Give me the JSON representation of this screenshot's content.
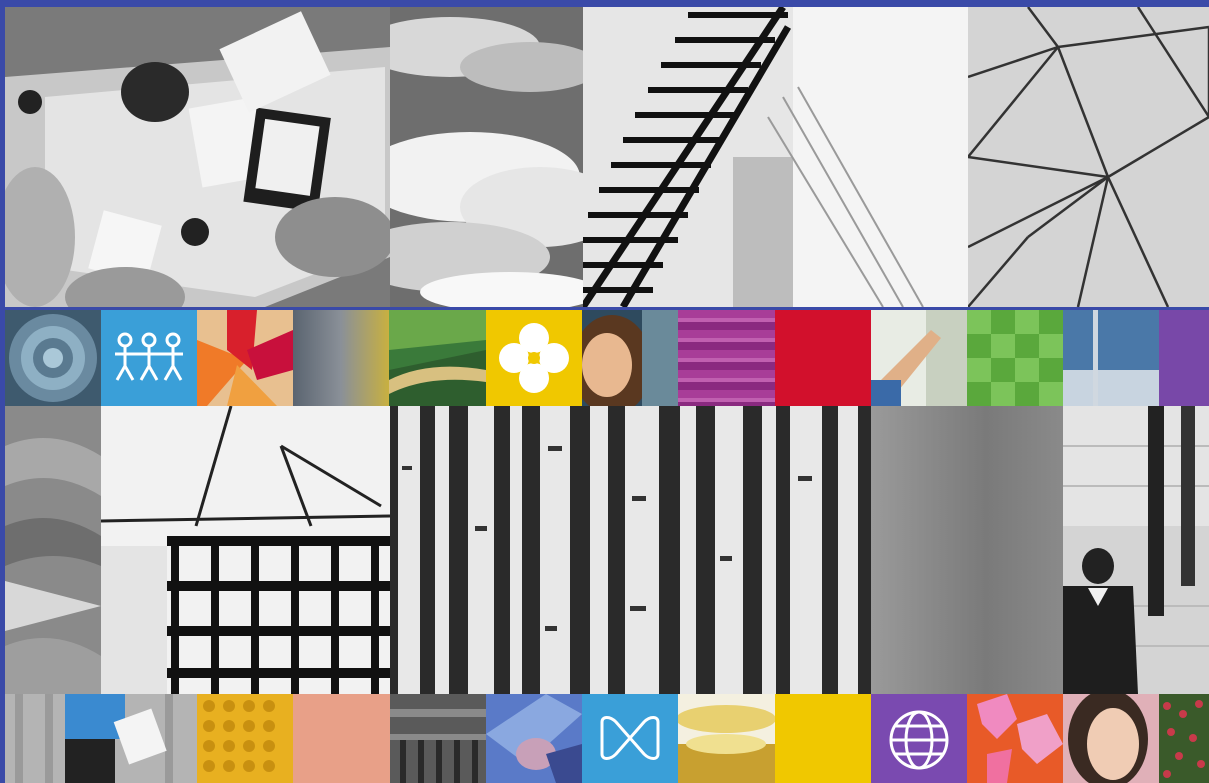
{
  "colors": {
    "frame": "#3a4aa8",
    "blue": "#3a9fd8",
    "yellow": "#f0c800",
    "magenta": "#a83d98",
    "red": "#d2102c",
    "green": "#5aa83c",
    "purple": "#7848a8",
    "salmon": "#e8a088",
    "violet": "#7a4ab0",
    "orange": "#e85a28"
  },
  "tiles": [
    {
      "name": "meeting-table-photo-tile",
      "icon": "meeting-photo"
    },
    {
      "name": "clouds-photo-tile",
      "icon": "clouds-photo"
    },
    {
      "name": "staircase-photo-tile",
      "icon": "staircase-photo"
    },
    {
      "name": "geodesic-structure-photo-tile",
      "icon": "geodesic-photo"
    },
    {
      "name": "succulent-photo-tile",
      "icon": "succulent-photo"
    },
    {
      "name": "people-icon-tile",
      "icon": "people-icon"
    },
    {
      "name": "red-abstract-tile",
      "icon": "abstract-shapes"
    },
    {
      "name": "gray-gradient-tile",
      "icon": "gradient"
    },
    {
      "name": "landscape-tile",
      "icon": "landscape"
    },
    {
      "name": "flower-icon-tile",
      "icon": "flower-icon"
    },
    {
      "name": "smiling-woman-tile",
      "icon": "portrait"
    },
    {
      "name": "magenta-stripes-tile",
      "icon": "stripes"
    },
    {
      "name": "red-square-tile",
      "icon": "solid"
    },
    {
      "name": "reaching-arm-tile",
      "icon": "arm-photo"
    },
    {
      "name": "green-grid-tile",
      "icon": "grid-pattern"
    },
    {
      "name": "glass-building-tile",
      "icon": "building-photo"
    },
    {
      "name": "purple-square-tile",
      "icon": "solid"
    },
    {
      "name": "fabric-texture-tile",
      "icon": "texture"
    },
    {
      "name": "construction-cranes-tile",
      "icon": "cranes-photo"
    },
    {
      "name": "birch-forest-tile",
      "icon": "forest-photo"
    },
    {
      "name": "gray-gradient-block-tile",
      "icon": "gradient"
    },
    {
      "name": "businessman-stairs-tile",
      "icon": "person-photo"
    },
    {
      "name": "person-with-paper-tile",
      "icon": "person-photo"
    },
    {
      "name": "yellow-dots-tile",
      "icon": "dots-pattern"
    },
    {
      "name": "salmon-square-tile",
      "icon": "solid"
    },
    {
      "name": "machinery-tile",
      "icon": "machinery-photo"
    },
    {
      "name": "handshake-tile",
      "icon": "handshake-photo"
    },
    {
      "name": "infinity-icon-tile",
      "icon": "infinity-icon"
    },
    {
      "name": "gold-object-tile",
      "icon": "gold-photo"
    },
    {
      "name": "yellow-square-tile",
      "icon": "solid"
    },
    {
      "name": "globe-icon-tile",
      "icon": "globe-icon"
    },
    {
      "name": "world-map-tile",
      "icon": "map-graphic"
    },
    {
      "name": "woman-portrait-tile",
      "icon": "portrait"
    },
    {
      "name": "flowers-field-tile",
      "icon": "flowers-photo"
    }
  ]
}
